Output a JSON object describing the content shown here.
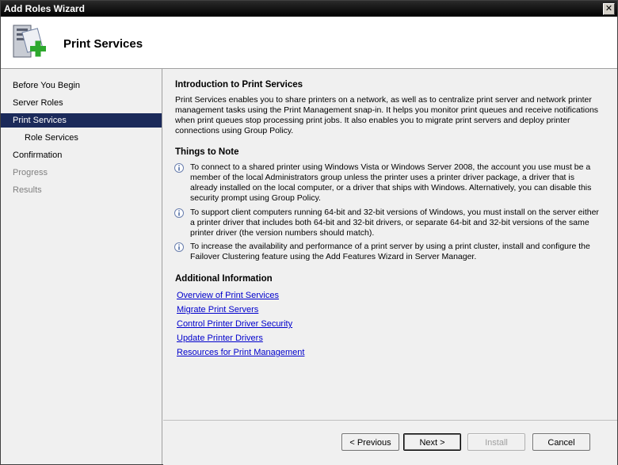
{
  "window": {
    "title": "Add Roles Wizard",
    "close_label": "✕"
  },
  "header": {
    "title": "Print Services",
    "icon": "server-add-icon"
  },
  "nav": {
    "items": [
      {
        "label": "Before You Begin",
        "state": "normal"
      },
      {
        "label": "Server Roles",
        "state": "normal"
      },
      {
        "label": "Print Services",
        "state": "selected"
      },
      {
        "label": "Role Services",
        "state": "sub"
      },
      {
        "label": "Confirmation",
        "state": "normal"
      },
      {
        "label": "Progress",
        "state": "disabled"
      },
      {
        "label": "Results",
        "state": "disabled"
      }
    ]
  },
  "content": {
    "intro_heading": "Introduction to Print Services",
    "intro_text": "Print Services enables you to share printers on a network, as well as to centralize print server and network printer management tasks using the Print Management snap-in. It helps you monitor print queues and receive notifications when print queues stop processing print jobs. It also enables you to migrate print servers and deploy printer connections using Group Policy.",
    "notes_heading": "Things to Note",
    "notes": [
      "To connect to a shared printer using Windows Vista or Windows Server 2008, the account you use must be a member of the local Administrators group unless the printer uses a printer driver package, a driver that is already installed on the local computer, or a driver that ships with Windows. Alternatively, you can disable this security prompt using Group Policy.",
      "To support client computers running 64-bit and 32-bit versions of Windows, you must install on the server either a printer driver that includes both 64-bit and 32-bit drivers, or separate 64-bit and 32-bit versions of the same printer driver (the version numbers should match).",
      "To increase the availability and performance of a print server by using a print cluster, install and configure the Failover Clustering feature using the Add Features Wizard in Server Manager."
    ],
    "additional_heading": "Additional Information",
    "links": [
      "Overview of Print Services",
      "Migrate Print Servers",
      "Control Printer Driver Security",
      "Update Printer Drivers",
      "Resources for Print Management"
    ]
  },
  "buttons": {
    "previous": "< Previous",
    "next": "Next >",
    "install": "Install",
    "cancel": "Cancel"
  }
}
